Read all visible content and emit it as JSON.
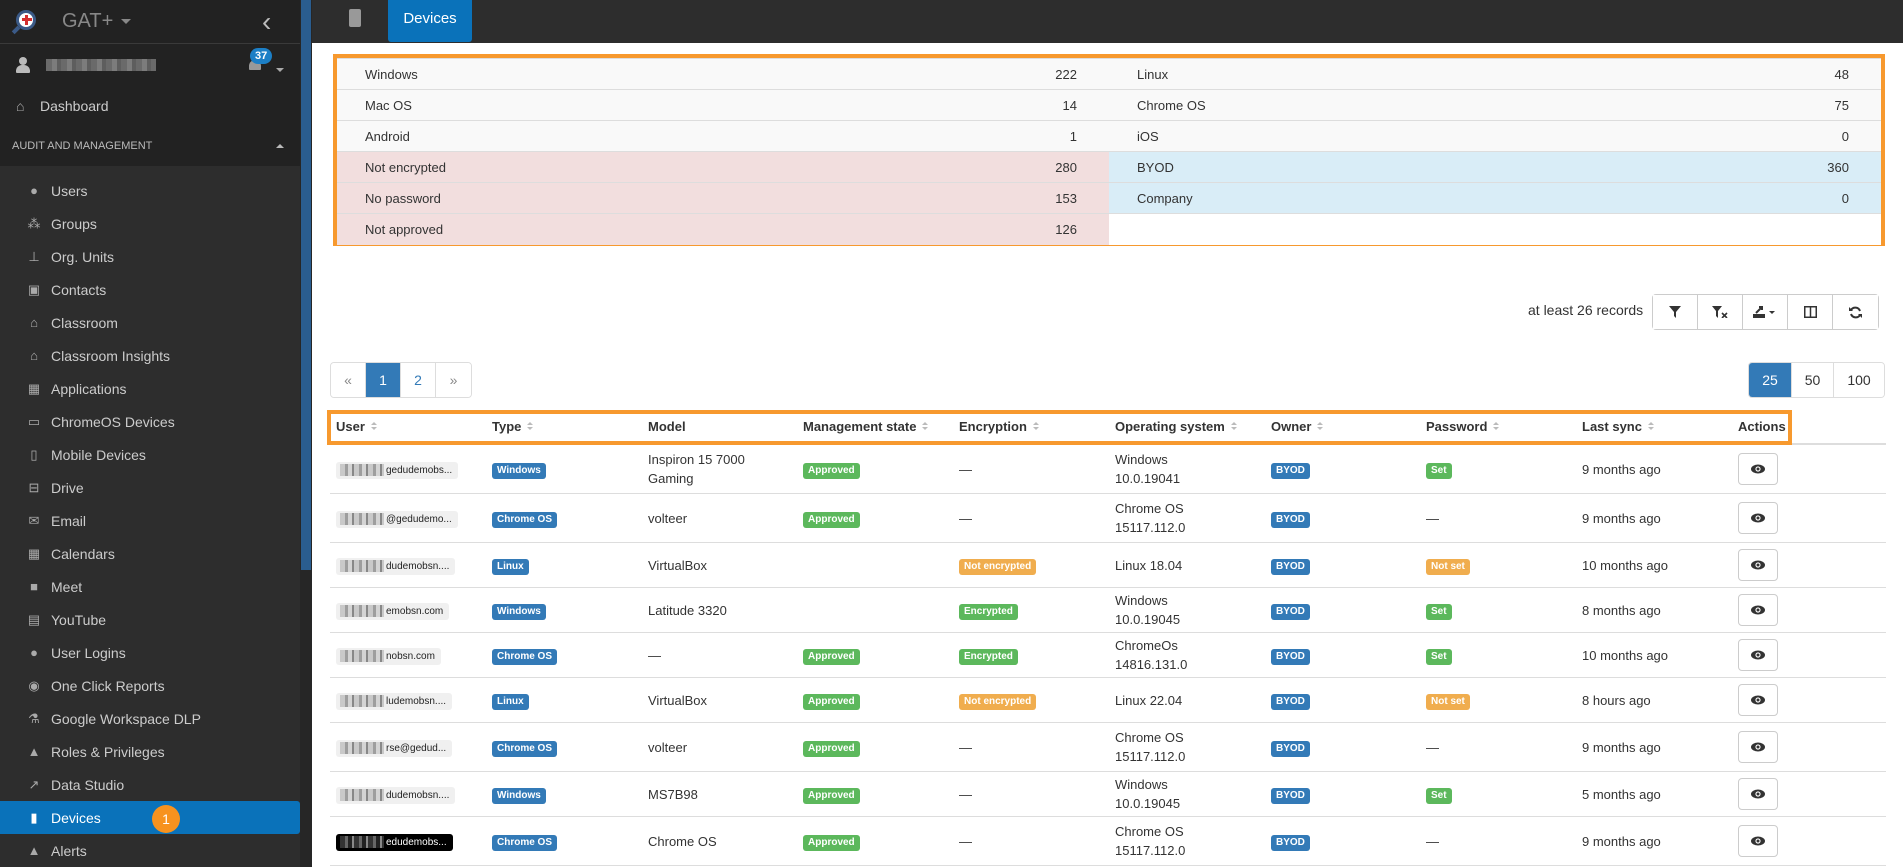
{
  "app": {
    "title": "GAT+",
    "notification_count": "37",
    "dashboard_label": "Dashboard",
    "section_label": "AUDIT AND MANAGEMENT"
  },
  "sidebar": {
    "items": [
      {
        "label": "Users",
        "icon": "user-icon"
      },
      {
        "label": "Groups",
        "icon": "users-icon"
      },
      {
        "label": "Org. Units",
        "icon": "sitemap-icon"
      },
      {
        "label": "Contacts",
        "icon": "address-book-icon"
      },
      {
        "label": "Classroom",
        "icon": "graduation-cap-icon"
      },
      {
        "label": "Classroom Insights",
        "icon": "graduation-search-icon"
      },
      {
        "label": "Applications",
        "icon": "grid-icon"
      },
      {
        "label": "ChromeOS Devices",
        "icon": "laptop-icon"
      },
      {
        "label": "Mobile Devices",
        "icon": "mobile-icon"
      },
      {
        "label": "Drive",
        "icon": "hdd-icon"
      },
      {
        "label": "Email",
        "icon": "envelope-icon"
      },
      {
        "label": "Calendars",
        "icon": "calendar-icon"
      },
      {
        "label": "Meet",
        "icon": "video-camera-icon"
      },
      {
        "label": "YouTube",
        "icon": "film-icon"
      },
      {
        "label": "User Logins",
        "icon": "globe-icon"
      },
      {
        "label": "One Click Reports",
        "icon": "eye-icon"
      },
      {
        "label": "Google Workspace DLP",
        "icon": "flask-icon"
      },
      {
        "label": "Roles & Privileges",
        "icon": "lock-icon"
      },
      {
        "label": "Data Studio",
        "icon": "line-chart-icon"
      },
      {
        "label": "Devices",
        "icon": "chip-icon",
        "active": true,
        "step": "1"
      },
      {
        "label": "Alerts",
        "icon": "bell-icon"
      }
    ]
  },
  "topbar": {
    "tab_label": "Devices"
  },
  "summary": {
    "rows": [
      {
        "left_label": "Windows",
        "left_value": "222",
        "right_label": "Linux",
        "right_value": "48"
      },
      {
        "left_label": "Mac OS",
        "left_value": "14",
        "right_label": "Chrome OS",
        "right_value": "75"
      },
      {
        "left_label": "Android",
        "left_value": "1",
        "right_label": "iOS",
        "right_value": "0"
      },
      {
        "left_label": "Not encrypted",
        "left_value": "280",
        "right_label": "BYOD",
        "right_value": "360"
      },
      {
        "left_label": "No password",
        "left_value": "153",
        "right_label": "Company",
        "right_value": "0"
      },
      {
        "left_label": "Not approved",
        "left_value": "126",
        "right_label": "",
        "right_value": ""
      }
    ]
  },
  "toolbar": {
    "records_text": "at least 26 records",
    "buttons": [
      "filter-icon",
      "clear-filter-icon",
      "export-icon",
      "columns-icon",
      "refresh-icon"
    ]
  },
  "pagination": {
    "prev": "«",
    "pages": [
      "1",
      "2"
    ],
    "current": "1",
    "next": "»",
    "page_sizes": [
      "25",
      "50",
      "100"
    ],
    "current_size": "25"
  },
  "table": {
    "headers": [
      {
        "label": "User",
        "sortable": true
      },
      {
        "label": "Type",
        "sortable": true
      },
      {
        "label": "Model",
        "sortable": false
      },
      {
        "label": "Management state",
        "sortable": true
      },
      {
        "label": "Encryption",
        "sortable": true
      },
      {
        "label": "Operating system",
        "sortable": true
      },
      {
        "label": "Owner",
        "sortable": true
      },
      {
        "label": "Password",
        "sortable": true
      },
      {
        "label": "Last sync",
        "sortable": true
      },
      {
        "label": "Actions",
        "sortable": false
      }
    ],
    "rows": [
      {
        "user": "gedudemobs...",
        "type": "Windows",
        "model": "Inspiron 15 7000 Gaming",
        "mgmt": "Approved",
        "encryption": "—",
        "os": "Windows 10.0.19041",
        "owner": "BYOD",
        "password": "Set",
        "last_sync": "9 months ago"
      },
      {
        "user": "@gedudemo...",
        "type": "Chrome OS",
        "model": "volteer",
        "mgmt": "Approved",
        "encryption": "—",
        "os": "Chrome OS 15117.112.0",
        "owner": "BYOD",
        "password": "—",
        "last_sync": "9 months ago"
      },
      {
        "user": "dudemobsn....",
        "type": "Linux",
        "model": "VirtualBox",
        "mgmt": "",
        "encryption": "Not encrypted",
        "os": "Linux 18.04",
        "owner": "BYOD",
        "password": "Not set",
        "last_sync": "10 months ago"
      },
      {
        "user": "emobsn.com",
        "type": "Windows",
        "model": "Latitude 3320",
        "mgmt": "",
        "encryption": "Encrypted",
        "os": "Windows 10.0.19045",
        "owner": "BYOD",
        "password": "Set",
        "last_sync": "8 months ago"
      },
      {
        "user": "nobsn.com",
        "type": "Chrome OS",
        "model": "—",
        "mgmt": "Approved",
        "encryption": "Encrypted",
        "os": "ChromeOs 14816.131.0",
        "owner": "BYOD",
        "password": "Set",
        "last_sync": "10 months ago"
      },
      {
        "user": "ludemobsn....",
        "type": "Linux",
        "model": "VirtualBox",
        "mgmt": "Approved",
        "encryption": "Not encrypted",
        "os": "Linux 22.04",
        "owner": "BYOD",
        "password": "Not set",
        "last_sync": "8 hours ago"
      },
      {
        "user": "rse@gedud...",
        "type": "Chrome OS",
        "model": "volteer",
        "mgmt": "Approved",
        "encryption": "—",
        "os": "Chrome OS 15117.112.0",
        "owner": "BYOD",
        "password": "—",
        "last_sync": "9 months ago"
      },
      {
        "user": "dudemobsn....",
        "type": "Windows",
        "model": "MS7B98",
        "mgmt": "Approved",
        "encryption": "—",
        "os": "Windows 10.0.19045",
        "owner": "BYOD",
        "password": "Set",
        "last_sync": "5 months ago"
      },
      {
        "user": "edudemobs...",
        "type": "Chrome OS",
        "model": "Chrome OS",
        "mgmt": "Approved",
        "encryption": "—",
        "os": "Chrome OS 15117.112.0",
        "owner": "BYOD",
        "password": "—",
        "last_sync": "9 months ago",
        "dark_user": true
      }
    ]
  },
  "colors": {
    "accent": "#0a72ba",
    "highlight_box": "#f7992e",
    "badge_blue": "#337ab7",
    "badge_green": "#5cb85c",
    "badge_orange": "#f0ad4e",
    "row_red": "#f2dede",
    "row_blue": "#d9edf7"
  }
}
